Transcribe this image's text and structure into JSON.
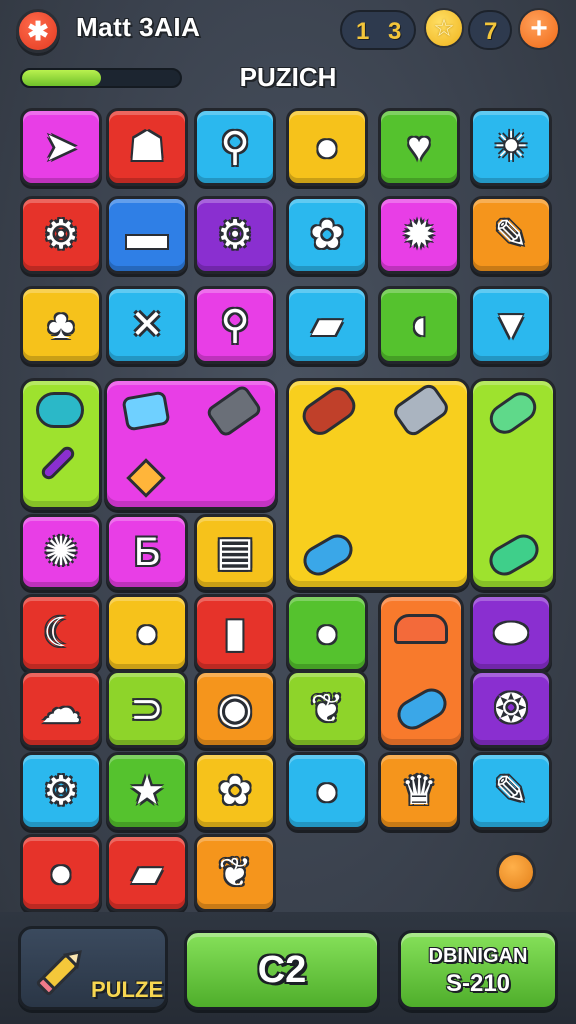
{
  "header": {
    "close_symbol": "✱",
    "player_name": "Matt 3AIA",
    "counter_a": "1",
    "counter_b": "3",
    "star_symbol": "☆",
    "counter_c": "7",
    "plus_symbol": "+",
    "progress": 0.5,
    "level_title": "PUZICH"
  },
  "tiles": [
    {
      "row": 0,
      "col": 0,
      "color": "#e83ee6",
      "icon": "paper-plane-icon",
      "glyph": "➤"
    },
    {
      "row": 0,
      "col": 1,
      "color": "#e6332a",
      "icon": "robot-icon",
      "glyph": "☗"
    },
    {
      "row": 0,
      "col": 2,
      "color": "#2bb8ee",
      "icon": "key-icon",
      "glyph": "⚲"
    },
    {
      "row": 0,
      "col": 3,
      "color": "#f6c21b",
      "icon": "beet-icon",
      "glyph": "●"
    },
    {
      "row": 0,
      "col": 4,
      "color": "#55c22e",
      "icon": "bone-icon",
      "glyph": "♥"
    },
    {
      "row": 0,
      "col": 5,
      "color": "#2bb8ee",
      "icon": "sun-icon",
      "glyph": "☀"
    },
    {
      "row": 1,
      "col": 0,
      "color": "#e6332a",
      "icon": "gear-icon",
      "glyph": "⚙"
    },
    {
      "row": 1,
      "col": 1,
      "color": "#2f7fe6",
      "icon": "candy-icon",
      "glyph": "▬"
    },
    {
      "row": 1,
      "col": 2,
      "color": "#8a2fd0",
      "icon": "gear-icon",
      "glyph": "⚙"
    },
    {
      "row": 1,
      "col": 3,
      "color": "#2bb8ee",
      "icon": "flower-icon",
      "glyph": "✿"
    },
    {
      "row": 1,
      "col": 4,
      "color": "#e83ee6",
      "icon": "sun-icon",
      "glyph": "✹"
    },
    {
      "row": 1,
      "col": 5,
      "color": "#f5951c",
      "icon": "pencil-icon",
      "glyph": "✎"
    },
    {
      "row": 2,
      "col": 0,
      "color": "#f6c21b",
      "icon": "frog-icon",
      "glyph": "♣"
    },
    {
      "row": 2,
      "col": 1,
      "color": "#2bb8ee",
      "icon": "crossed-sticks-icon",
      "glyph": "✕"
    },
    {
      "row": 2,
      "col": 2,
      "color": "#e83ee6",
      "icon": "magnifier-icon",
      "glyph": "⚲"
    },
    {
      "row": 2,
      "col": 3,
      "color": "#2bb8ee",
      "icon": "bandage-icon",
      "glyph": "▰"
    },
    {
      "row": 2,
      "col": 4,
      "color": "#55c22e",
      "icon": "fish-icon",
      "glyph": "◖"
    },
    {
      "row": 2,
      "col": 5,
      "color": "#2bb8ee",
      "icon": "carrot-icon",
      "glyph": "▼"
    },
    {
      "row": 4,
      "col": 0,
      "color": "#e83ee6",
      "icon": "virus-icon",
      "glyph": "✺"
    },
    {
      "row": 4,
      "col": 1,
      "color": "#e83ee6",
      "icon": "letter-b-icon",
      "glyph": "Ƃ"
    },
    {
      "row": 4,
      "col": 2,
      "color": "#f6c21b",
      "icon": "can-icon",
      "glyph": "▤"
    },
    {
      "row": 5,
      "col": 0,
      "color": "#e6332a",
      "icon": "moon-icon",
      "glyph": "☾"
    },
    {
      "row": 5,
      "col": 1,
      "color": "#f6c21b",
      "icon": "apple-icon",
      "glyph": "●"
    },
    {
      "row": 5,
      "col": 2,
      "color": "#e6332a",
      "icon": "battery-icon",
      "glyph": "▮"
    },
    {
      "row": 5,
      "col": 3,
      "color": "#55c22e",
      "icon": "berry-icon",
      "glyph": "●"
    },
    {
      "row": 5,
      "col": 5,
      "color": "#8a2fd0",
      "icon": "lemon-icon",
      "glyph": "⬬"
    },
    {
      "row": 6,
      "col": 0,
      "color": "#e6332a",
      "icon": "ghost-icon",
      "glyph": "☁"
    },
    {
      "row": 6,
      "col": 1,
      "color": "#8ed42a",
      "icon": "hook-icon",
      "glyph": "⊃"
    },
    {
      "row": 6,
      "col": 2,
      "color": "#f5951c",
      "icon": "roll-icon",
      "glyph": "◉"
    },
    {
      "row": 6,
      "col": 3,
      "color": "#8ed42a",
      "icon": "leaf-icon",
      "glyph": "❦"
    },
    {
      "row": 6,
      "col": 5,
      "color": "#8a2fd0",
      "icon": "cookie-icon",
      "glyph": "❂"
    },
    {
      "row": 7,
      "col": 0,
      "color": "#2bb8ee",
      "icon": "gear-icon",
      "glyph": "⚙"
    },
    {
      "row": 7,
      "col": 1,
      "color": "#55c22e",
      "icon": "star-icon",
      "glyph": "★"
    },
    {
      "row": 7,
      "col": 2,
      "color": "#f6c21b",
      "icon": "flower-icon",
      "glyph": "✿"
    },
    {
      "row": 7,
      "col": 3,
      "color": "#2bb8ee",
      "icon": "tomato-icon",
      "glyph": "●"
    },
    {
      "row": 7,
      "col": 4,
      "color": "#f5951c",
      "icon": "trophy-icon",
      "glyph": "♛"
    },
    {
      "row": 7,
      "col": 5,
      "color": "#2bb8ee",
      "icon": "pencil-icon",
      "glyph": "✎"
    },
    {
      "row": 8,
      "col": 0,
      "color": "#e6332a",
      "icon": "orange-icon",
      "glyph": "●"
    },
    {
      "row": 8,
      "col": 1,
      "color": "#e6332a",
      "icon": "potion-icon",
      "glyph": "▰"
    },
    {
      "row": 8,
      "col": 2,
      "color": "#f5951c",
      "icon": "leaf-icon",
      "glyph": "❦"
    }
  ],
  "merged_blocks": [
    {
      "name": "magenta-block",
      "color": "#e83ee6"
    },
    {
      "name": "yellow-block",
      "color": "#f8cf1e"
    },
    {
      "name": "lime-block",
      "color": "#9ee22e"
    },
    {
      "name": "lime-left-block",
      "color": "#9ee22e"
    },
    {
      "name": "orange-column-block",
      "color": "#f87a2c"
    }
  ],
  "bottom": {
    "hint_label": "PULZE",
    "score_label": "C2",
    "bonus_title": "DBINIGAN",
    "bonus_price": "S-210"
  }
}
